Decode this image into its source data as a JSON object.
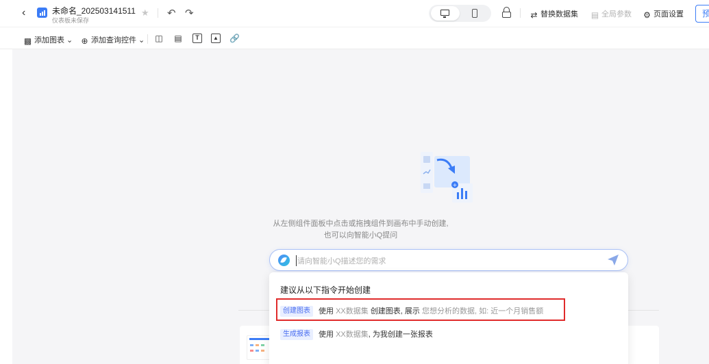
{
  "header": {
    "title": "未命名_202503141511",
    "subtitle": "仪表板未保存",
    "actions": {
      "replace_dataset": "替换数据集",
      "global_params": "全局参数",
      "page_settings": "页面设置",
      "preview": "预"
    }
  },
  "toolbar": {
    "add_chart": "添加图表",
    "add_filter": "添加查询控件"
  },
  "empty_state": {
    "hint_line1": "从左侧组件面板中点击或拖拽组件到画布中手动创建,",
    "hint_line2": "也可以向智能小Q提问"
  },
  "ask": {
    "placeholder": "请向智能小Q描述您的需求"
  },
  "suggestions": {
    "title": "建议从以下指令开始创建",
    "items": [
      {
        "tag": "创建图表",
        "parts": [
          "使用",
          "XX数据集",
          "创建图表, 展示",
          "您想分析的数据, 如: 近一个月销售额"
        ]
      },
      {
        "tag": "生成报表",
        "parts": [
          "使用",
          "XX数据集",
          ", 为我创建一张报表"
        ]
      }
    ]
  },
  "colors": {
    "accent": "#3b7cf6",
    "highlight_border": "#e02a2a",
    "tag_text": "#4a6ef0",
    "tag_bg": "#e9efff"
  },
  "icons": [
    "back-icon",
    "dashboard-icon",
    "star-icon",
    "undo-icon",
    "redo-icon",
    "desktop-icon",
    "mobile-icon",
    "lock-icon",
    "dataset-swap-icon",
    "params-icon",
    "gear-icon",
    "bar-chart-icon",
    "search-filter-icon",
    "layout-icon",
    "tab-icon",
    "text-icon",
    "image-icon",
    "link-icon",
    "ai-assistant-icon",
    "send-icon"
  ]
}
